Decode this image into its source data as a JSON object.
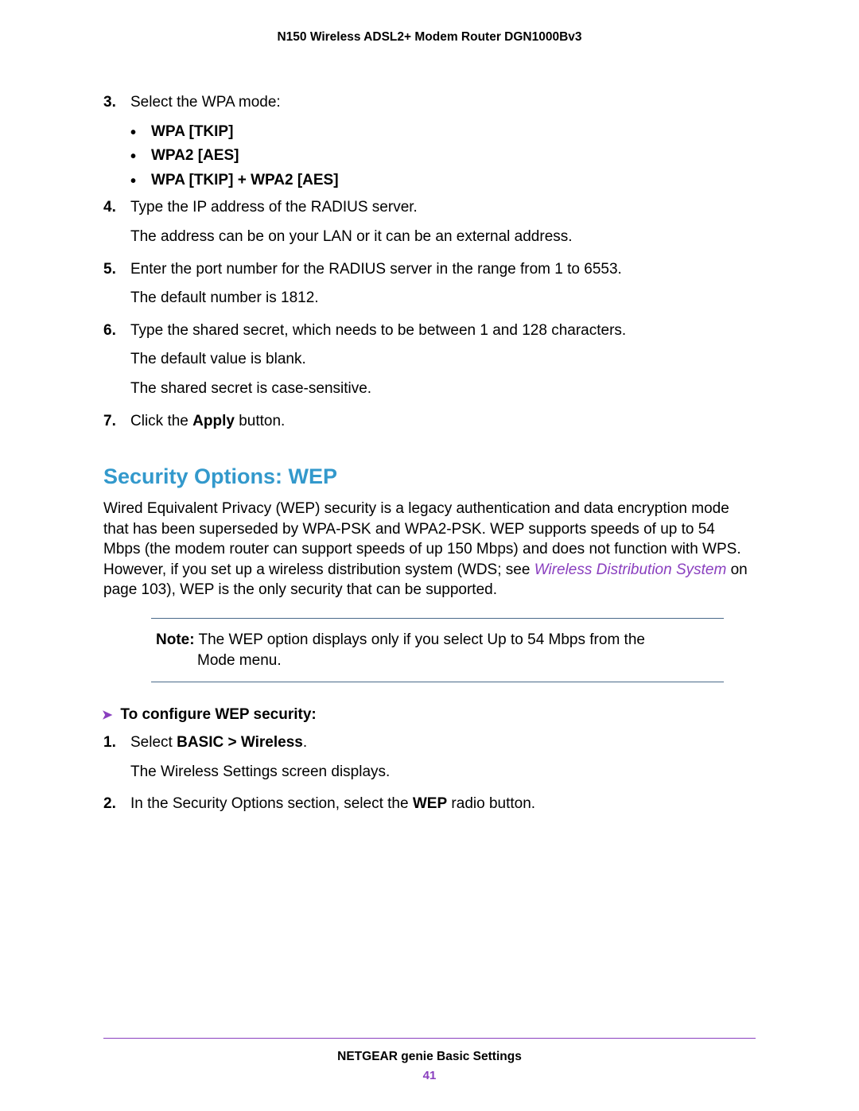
{
  "header": {
    "title": "N150 Wireless ADSL2+ Modem Router DGN1000Bv3"
  },
  "steps_a": {
    "s3": {
      "num": "3.",
      "text": "Select the WPA mode:",
      "bullets": [
        "WPA [TKIP]",
        "WPA2 [AES]",
        "WPA [TKIP] + WPA2 [AES]"
      ]
    },
    "s4": {
      "num": "4.",
      "line1": "Type the IP address of the RADIUS server.",
      "line2": "The address can be on your LAN or it can be an external address."
    },
    "s5": {
      "num": "5.",
      "line1": "Enter the port number for the RADIUS server in the range from 1 to 6553.",
      "line2": "The default number is 1812."
    },
    "s6": {
      "num": "6.",
      "line1": "Type the shared secret, which needs to be between 1 and 128 characters.",
      "line2": "The default value is blank.",
      "line3": "The shared secret is case-sensitive."
    },
    "s7": {
      "num": "7.",
      "pre": "Click the ",
      "bold": "Apply",
      "post": " button."
    }
  },
  "section": {
    "heading": "Security Options: WEP",
    "para_pre": "Wired Equivalent Privacy (WEP) security is a legacy authentication and data encryption mode that has been superseded by WPA-PSK and WPA2-PSK. WEP supports speeds of up to 54 Mbps (the modem router can support speeds of up 150 Mbps) and does not function with WPS. However, if you set up a wireless distribution system (WDS; see ",
    "link": "Wireless Distribution System",
    "para_post": " on page 103), WEP is the only security that can be supported."
  },
  "note": {
    "lead": "Note:",
    "text1": " The WEP option displays only if you select Up to 54 Mbps from the",
    "text2": "Mode menu."
  },
  "procedure": {
    "title": "To configure WEP security:",
    "s1": {
      "num": "1.",
      "pre": "Select ",
      "bold": "BASIC > Wireless",
      "post": ".",
      "line2": "The Wireless Settings screen displays."
    },
    "s2": {
      "num": "2.",
      "pre": "In the Security Options section, select the ",
      "bold": "WEP",
      "post": " radio button."
    }
  },
  "footer": {
    "text": "NETGEAR genie Basic Settings",
    "page": "41"
  }
}
